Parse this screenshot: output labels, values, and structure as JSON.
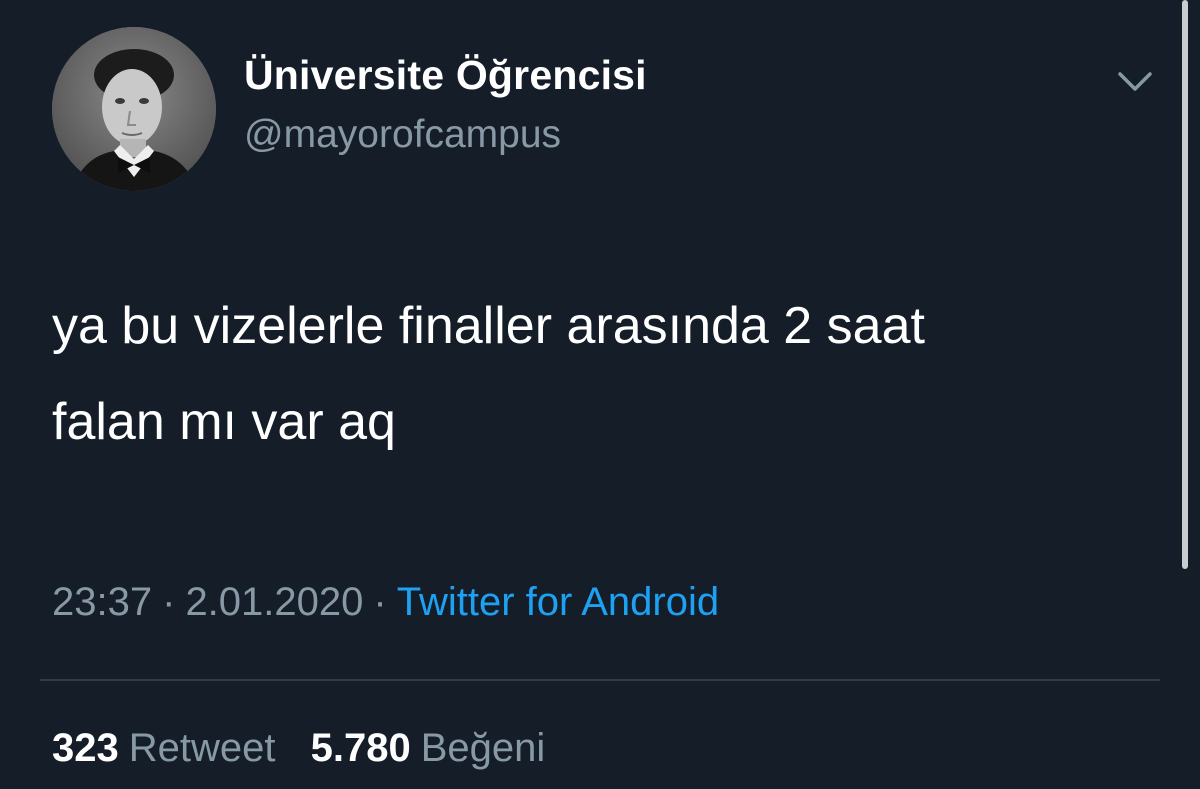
{
  "tweet": {
    "author": {
      "display_name": "Üniversite Öğrencisi",
      "handle": "@mayorofcampus",
      "avatar_icon": "profile-photo"
    },
    "menu_icon": "chevron-down-icon",
    "text_lines": [
      "ya bu vizelerle finaller arasında 2 saat",
      "falan mı var aq"
    ],
    "time": "23:37",
    "separator": "·",
    "date": "2.01.2020",
    "source": "Twitter for Android",
    "retweet_count": "323",
    "retweet_label": "Retweet",
    "like_count": "5.780",
    "like_label": "Beğeni"
  },
  "colors": {
    "background": "#151d29",
    "text_primary": "#ffffff",
    "text_secondary": "#8899a6",
    "link": "#1da1f2",
    "divider": "#2f3b47"
  }
}
